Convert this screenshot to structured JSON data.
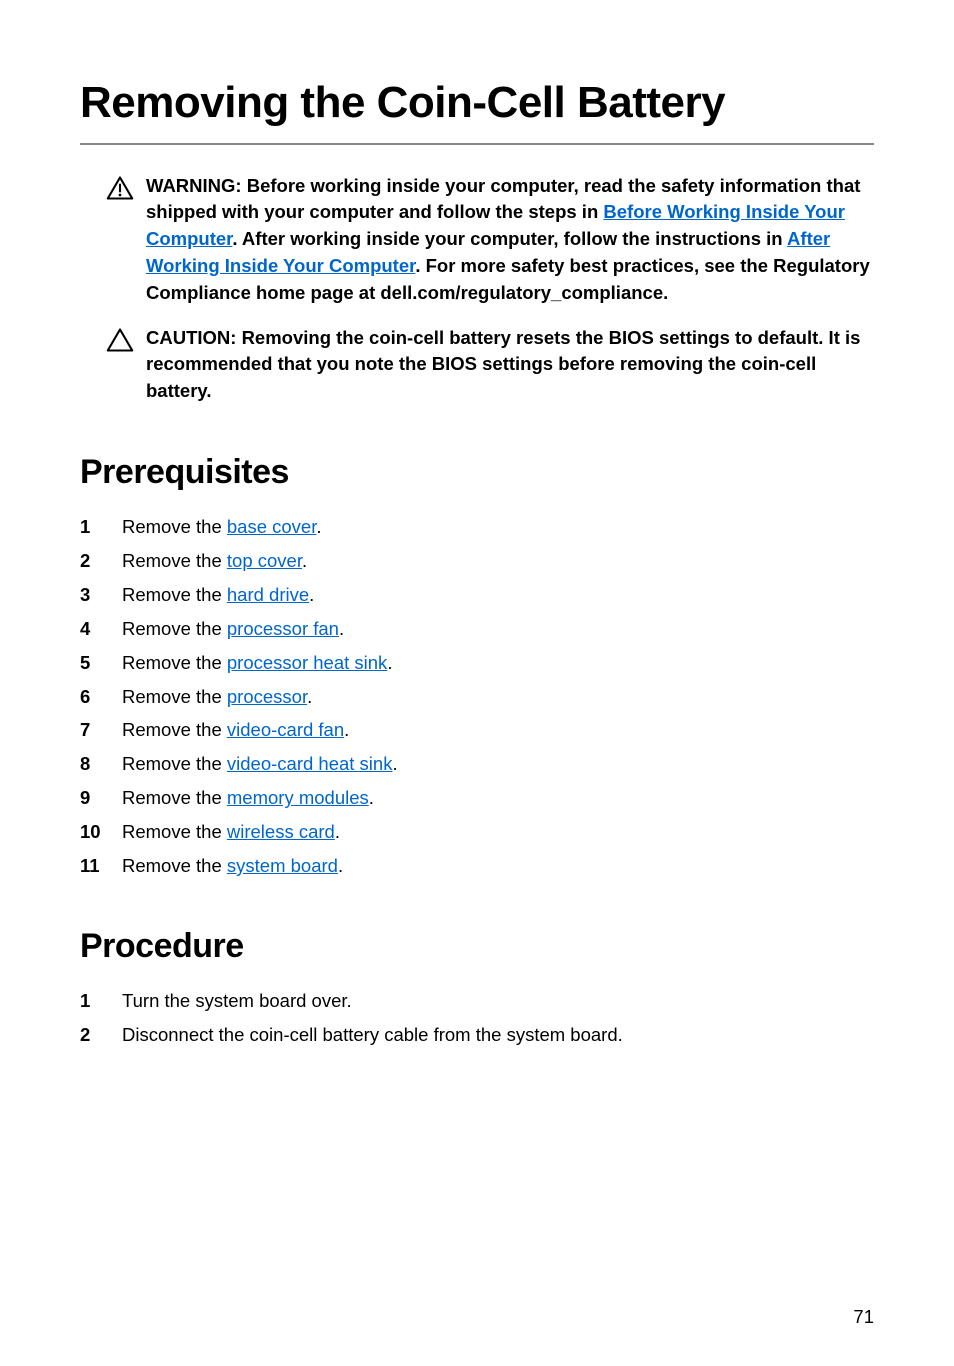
{
  "page_title": "Removing the Coin-Cell Battery",
  "admonitions": [
    {
      "icon": "warning",
      "parts": [
        {
          "t": "WARNING: Before working inside your computer, read the safety information that shipped with your computer and follow the steps in "
        },
        {
          "t": "Before Working Inside Your Computer",
          "link": true
        },
        {
          "t": ". After working inside your computer, follow the instructions in "
        },
        {
          "t": "After Working Inside Your Computer",
          "link": true
        },
        {
          "t": ". For more safety best practices, see the Regulatory Compliance home page at dell.com/regulatory_compliance. "
        }
      ]
    },
    {
      "icon": "caution",
      "parts": [
        {
          "t": "CAUTION: Removing the coin-cell battery resets the BIOS settings to default. It is recommended that you note the BIOS settings before removing the coin-cell battery."
        }
      ]
    }
  ],
  "sections": [
    {
      "heading": "Prerequisites",
      "items": [
        [
          {
            "t": "Remove the "
          },
          {
            "t": "base cover",
            "link": true
          },
          {
            "t": "."
          }
        ],
        [
          {
            "t": "Remove the "
          },
          {
            "t": "top cover",
            "link": true
          },
          {
            "t": "."
          }
        ],
        [
          {
            "t": "Remove the "
          },
          {
            "t": "hard drive",
            "link": true
          },
          {
            "t": "."
          }
        ],
        [
          {
            "t": "Remove the "
          },
          {
            "t": "processor fan",
            "link": true
          },
          {
            "t": "."
          }
        ],
        [
          {
            "t": "Remove the "
          },
          {
            "t": "processor heat sink",
            "link": true
          },
          {
            "t": "."
          }
        ],
        [
          {
            "t": "Remove the "
          },
          {
            "t": "processor",
            "link": true
          },
          {
            "t": "."
          }
        ],
        [
          {
            "t": "Remove the "
          },
          {
            "t": "video-card fan",
            "link": true
          },
          {
            "t": "."
          }
        ],
        [
          {
            "t": "Remove the "
          },
          {
            "t": "video-card heat sink",
            "link": true
          },
          {
            "t": "."
          }
        ],
        [
          {
            "t": "Remove the "
          },
          {
            "t": "memory modules",
            "link": true
          },
          {
            "t": "."
          }
        ],
        [
          {
            "t": "Remove the "
          },
          {
            "t": "wireless card",
            "link": true
          },
          {
            "t": "."
          }
        ],
        [
          {
            "t": "Remove the "
          },
          {
            "t": "system board",
            "link": true
          },
          {
            "t": "."
          }
        ]
      ]
    },
    {
      "heading": "Procedure",
      "items": [
        [
          {
            "t": "Turn the system board over."
          }
        ],
        [
          {
            "t": "Disconnect the coin-cell battery cable from the system board."
          }
        ]
      ]
    }
  ],
  "page_number": "71"
}
